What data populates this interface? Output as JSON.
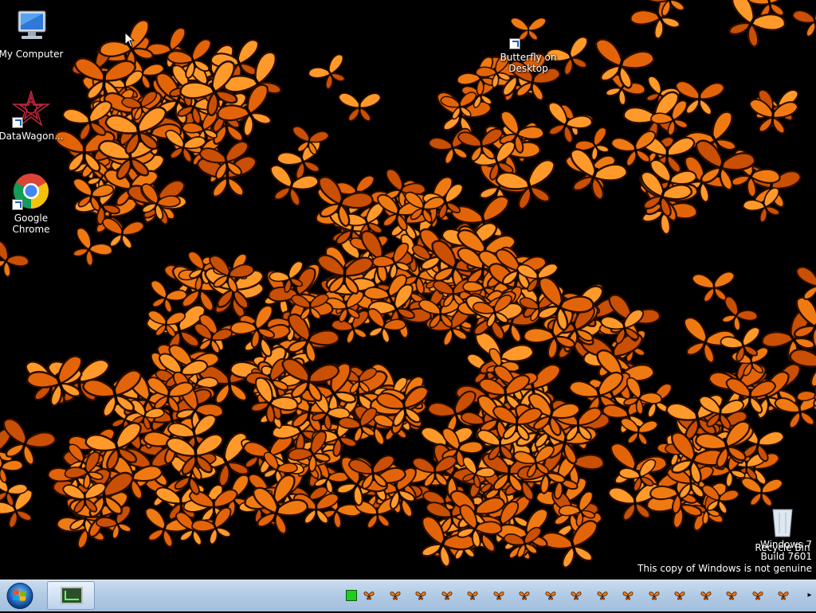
{
  "desktop": {
    "icons": [
      {
        "label": "My Computer",
        "icon": "computer-icon"
      },
      {
        "label": "DataWagon...",
        "icon": "datawagon-icon"
      },
      {
        "label": "Google Chrome",
        "icon": "chrome-icon"
      },
      {
        "label": "Butterfly on Desktop",
        "icon": "butterfly-icon"
      },
      {
        "label": "Recycle Bin",
        "icon": "recycle-bin-icon"
      }
    ],
    "wallpaper": {
      "background": "#000000",
      "butterfly_colors": [
        "#f07a12",
        "#e36408",
        "#ff9a2a",
        "#c94f05"
      ]
    }
  },
  "watermark": {
    "line1": "Windows 7",
    "line2": "Build 7601",
    "line3": "This copy of Windows is not genuine"
  },
  "taskbar": {
    "start_icon": "windows-start-orb-icon",
    "running_app_icon": "monitor-app-icon",
    "tray_icons": "butterfly-tray-icon",
    "tray_expand": "▸",
    "colors": {
      "bar_top": "#c9dcef",
      "bar_bottom": "#a3bedc",
      "tray_green": "#22cc22"
    }
  }
}
